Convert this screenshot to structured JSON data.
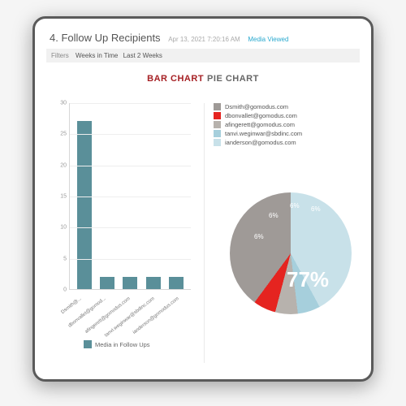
{
  "header": {
    "title": "4. Follow Up Recipients",
    "timestamp": "Apr 13, 2021 7:20:16 AM",
    "status_link": "Media Viewed"
  },
  "filters": {
    "label": "Filters",
    "field": "Weeks in Time",
    "value": "Last 2 Weeks"
  },
  "tabs": {
    "active": "BAR CHART",
    "inactive": "PIE CHART"
  },
  "bar_chart": {
    "legend_label": "Media in Follow Ups",
    "legend_color": "#5a8f99",
    "y_ticks": [
      0,
      5,
      10,
      15,
      20,
      25,
      30
    ]
  },
  "pie_legend": [
    {
      "label": "Dsmith@gomodus.com",
      "color": "#9f9a97"
    },
    {
      "label": "dbonvallet@gomodus.com",
      "color": "#e52420"
    },
    {
      "label": "afingerett@gomodus.com",
      "color": "#b7b2ad"
    },
    {
      "label": "tanvi.weginwar@sbdinc.com",
      "color": "#a6cfdc"
    },
    {
      "label": "ianderson@gomodus.com",
      "color": "#c8e1e9"
    }
  ],
  "pie_labels": {
    "center": "77%",
    "s1": "6%",
    "s2": "6%",
    "s3": "6%",
    "s4": "6%"
  },
  "chart_data": [
    {
      "type": "bar",
      "title": "Media in Follow Ups",
      "categories": [
        "Dsmith@...",
        "dbonvallet@gomod...",
        "afingerett@gomodus.com",
        "tanvi.weginwar@sbdinc.com",
        "ianderson@gomodus.com"
      ],
      "values": [
        27,
        2,
        2,
        2,
        2
      ],
      "ylim": [
        0,
        30
      ],
      "color": "#5a8f99"
    },
    {
      "type": "pie",
      "series": [
        {
          "name": "Dsmith@gomodus.com",
          "value": 77,
          "color": "#9f9a97"
        },
        {
          "name": "dbonvallet@gomodus.com",
          "value": 6,
          "color": "#e52420"
        },
        {
          "name": "afingerett@gomodus.com",
          "value": 6,
          "color": "#b7b2ad"
        },
        {
          "name": "tanvi.weginwar@sbdinc.com",
          "value": 6,
          "color": "#a6cfdc"
        },
        {
          "name": "ianderson@gomodus.com",
          "value": 6,
          "color": "#c8e1e9"
        }
      ]
    }
  ]
}
